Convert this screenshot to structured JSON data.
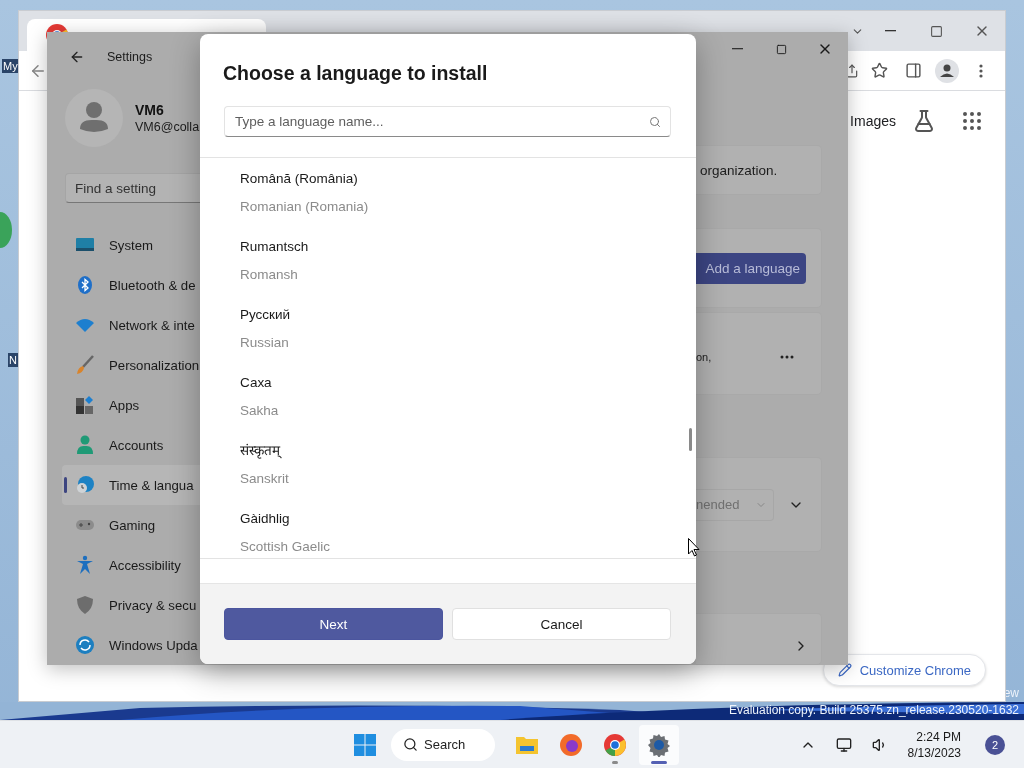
{
  "desktop": {
    "icon_labels": [
      "My",
      "N"
    ],
    "watermark": [
      "ew",
      "Evaluation copy. Build 25375.zn_release.230520-1632"
    ]
  },
  "chrome": {
    "toolbar_link": "Images",
    "customize_button": "Customize Chrome"
  },
  "settings": {
    "title": "Settings",
    "account": {
      "name": "VM6",
      "email": "VM6@colla"
    },
    "search": {
      "placeholder": "Find a setting"
    },
    "nav": [
      {
        "label": "System",
        "kind": "system",
        "selected": false
      },
      {
        "label": "Bluetooth & de",
        "kind": "bluetooth",
        "selected": false
      },
      {
        "label": "Network & inte",
        "kind": "network",
        "selected": false
      },
      {
        "label": "Personalization",
        "kind": "personalization",
        "selected": false
      },
      {
        "label": "Apps",
        "kind": "apps",
        "selected": false
      },
      {
        "label": "Accounts",
        "kind": "accounts",
        "selected": false
      },
      {
        "label": "Time & langua",
        "kind": "time",
        "selected": true
      },
      {
        "label": "Gaming",
        "kind": "gaming",
        "selected": false
      },
      {
        "label": "Accessibility",
        "kind": "accessibility",
        "selected": false
      },
      {
        "label": "Privacy & secu",
        "kind": "privacy",
        "selected": false
      },
      {
        "label": "Windows Upda",
        "kind": "update",
        "selected": false
      }
    ],
    "content": {
      "text_1": "organization.",
      "add_button": "Add a language",
      "text_2": "on,",
      "dropdown": "nended"
    }
  },
  "dialog": {
    "title": "Choose a language to install",
    "search": {
      "placeholder": "Type a language name..."
    },
    "languages": [
      {
        "native": "Română (România)",
        "english": "Romanian (Romania)"
      },
      {
        "native": "Rumantsch",
        "english": "Romansh"
      },
      {
        "native": "Русский",
        "english": "Russian"
      },
      {
        "native": "Саха",
        "english": "Sakha"
      },
      {
        "native": "संस्कृतम्",
        "english": "Sanskrit"
      },
      {
        "native": "Gàidhlig",
        "english": "Scottish Gaelic"
      }
    ],
    "buttons": [
      {
        "label": "Next",
        "kind": "primary"
      },
      {
        "label": "Cancel",
        "kind": "secondary"
      }
    ]
  },
  "taskbar": {
    "search": "Search",
    "apps": [
      {
        "kind": "explorer",
        "selected": false,
        "running": false
      },
      {
        "kind": "firefox",
        "selected": false,
        "running": false
      },
      {
        "kind": "chrome",
        "selected": false,
        "running": true
      },
      {
        "kind": "settings",
        "selected": true,
        "running": true
      }
    ],
    "time": "2:24 PM",
    "date": "8/13/2023",
    "notifications": "2"
  }
}
